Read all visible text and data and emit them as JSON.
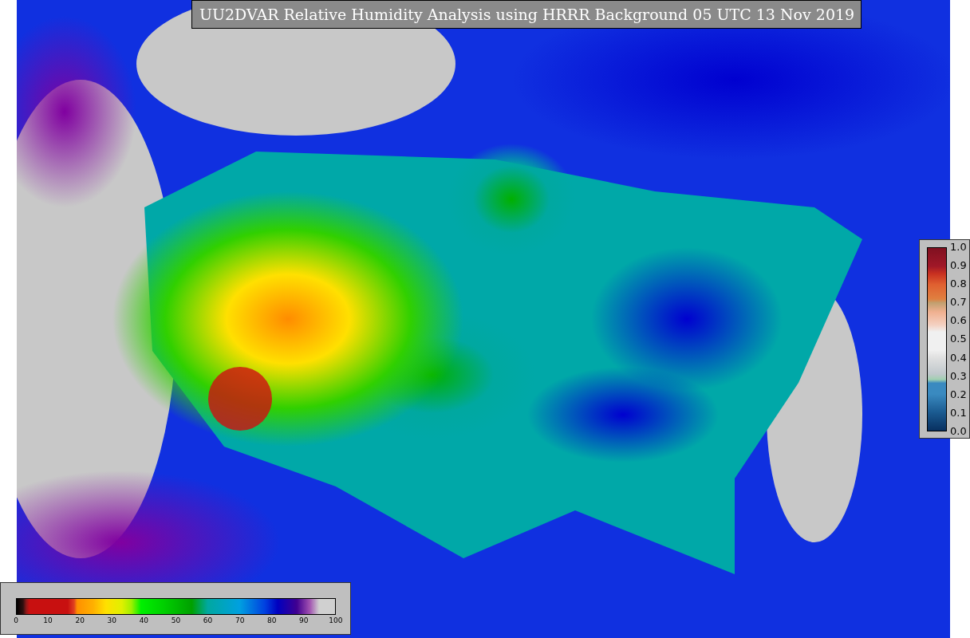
{
  "title": "UU2DVAR Relative Humidity Analysis using HRRR Background 05 UTC 13 Nov 2019",
  "humidity_colorbar": {
    "ticks": [
      "0",
      "10",
      "20",
      "30",
      "40",
      "50",
      "60",
      "70",
      "80",
      "90",
      "100"
    ]
  },
  "observation_colorbar": {
    "ticks": [
      "1.0",
      "0.9",
      "0.8",
      "0.7",
      "0.6",
      "0.5",
      "0.4",
      "0.3",
      "0.2",
      "0.1",
      "0.0"
    ]
  }
}
